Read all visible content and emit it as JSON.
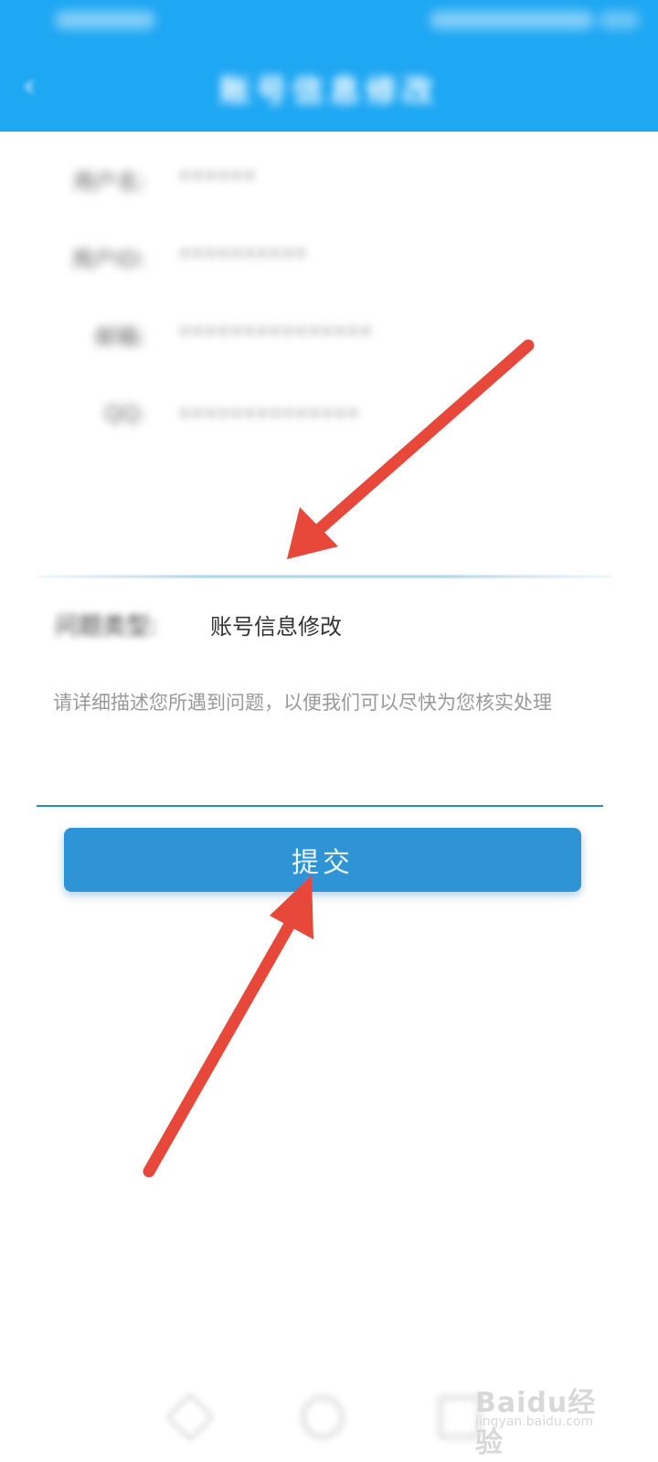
{
  "header": {
    "title": "账号信息修改",
    "back_icon": "‹"
  },
  "info_rows": [
    {
      "label": "用户名:",
      "value": "••••••"
    },
    {
      "label": "用户ID:",
      "value": "••••••••••"
    },
    {
      "label": "邮箱:",
      "value": "•••••••••••••••"
    },
    {
      "label": "QQ:",
      "value": "••••••••••••••"
    }
  ],
  "notice": "",
  "question": {
    "type_label": "问题类型:",
    "type_value": "账号信息修改"
  },
  "description": {
    "placeholder": "请详细描述您所遇到问题，以便我们可以尽快为您核实处理"
  },
  "submit_label": "提交",
  "watermark": {
    "logo": "Baidu经验",
    "sub": "jingyan.baidu.com"
  },
  "colors": {
    "primary": "#1ea7f3",
    "button": "#2f94d6",
    "arrow": "#e8483a"
  }
}
